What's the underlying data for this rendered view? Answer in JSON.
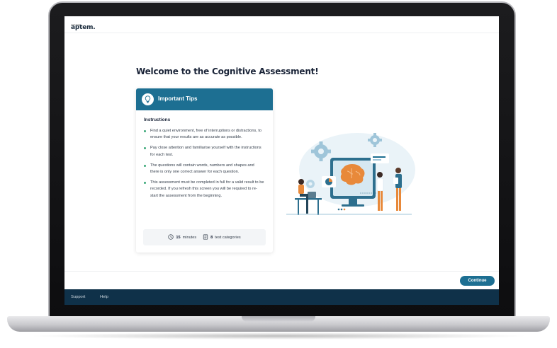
{
  "header": {
    "logo_text": "aptem.",
    "logo_sub": "ASSESS"
  },
  "main": {
    "title": "Welcome to the Cognitive Assessment!",
    "tips": {
      "header_title": "Important Tips",
      "instructions_heading": "Instructions",
      "items": [
        "Find a quiet environment, free of interruptions or distractions, to ensure that your results are as accurate as possible.",
        "Pay close attention and familiarise yourself with the instructions for each test.",
        "The questions will contain words, numbers and shapes and there is only one correct answer for each question.",
        "This assessment must be completed in full for a valid result to be recorded.  If you refresh this screen you will be required to re-start the assessment from the beginning."
      ],
      "duration_value": "15",
      "duration_unit": "minutes",
      "categories_value": "8",
      "categories_unit": "test categories"
    }
  },
  "actions": {
    "continue_label": "Continue"
  },
  "footer": {
    "support_label": "Support",
    "help_label": "Help"
  },
  "colors": {
    "accent": "#1d6f92",
    "bullet": "#3aa878",
    "footer": "#0f3149",
    "illustration_orange": "#e8893a"
  }
}
